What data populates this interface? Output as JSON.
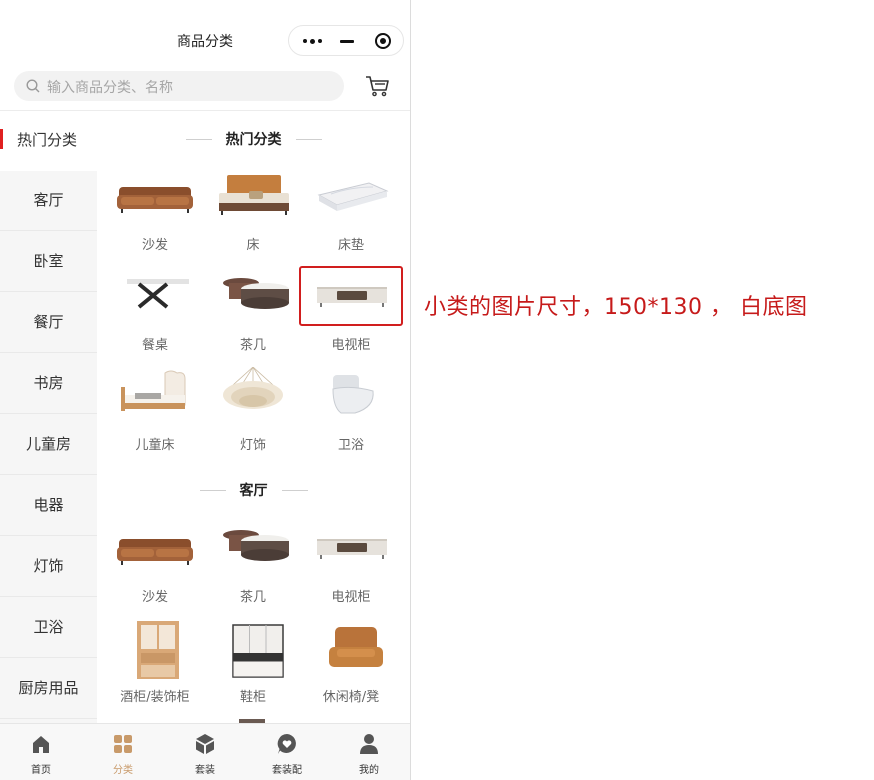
{
  "header": {
    "title": "商品分类"
  },
  "search": {
    "placeholder": "输入商品分类、名称"
  },
  "sidebar": {
    "items": [
      {
        "label": "热门分类",
        "active": true
      },
      {
        "label": "客厅"
      },
      {
        "label": "卧室"
      },
      {
        "label": "餐厅"
      },
      {
        "label": "书房"
      },
      {
        "label": "儿童房"
      },
      {
        "label": "电器"
      },
      {
        "label": "灯饰"
      },
      {
        "label": "卫浴"
      },
      {
        "label": "厨房用品"
      }
    ]
  },
  "sections": [
    {
      "title": "热门分类",
      "items": [
        {
          "label": "沙发",
          "icon": "sofa"
        },
        {
          "label": "床",
          "icon": "bed"
        },
        {
          "label": "床垫",
          "icon": "mattress"
        },
        {
          "label": "餐桌",
          "icon": "dining-table"
        },
        {
          "label": "茶几",
          "icon": "coffee-table"
        },
        {
          "label": "电视柜",
          "icon": "tv-cabinet"
        },
        {
          "label": "儿童床",
          "icon": "kids-bed"
        },
        {
          "label": "灯饰",
          "icon": "chandelier"
        },
        {
          "label": "卫浴",
          "icon": "toilet"
        }
      ]
    },
    {
      "title": "客厅",
      "items": [
        {
          "label": "沙发",
          "icon": "sofa"
        },
        {
          "label": "茶几",
          "icon": "coffee-table"
        },
        {
          "label": "电视柜",
          "icon": "tv-cabinet"
        },
        {
          "label": "酒柜/装饰柜",
          "icon": "wine-cabinet"
        },
        {
          "label": "鞋柜",
          "icon": "shoe-cabinet"
        },
        {
          "label": "休闲椅/凳",
          "icon": "lounge-chair"
        }
      ]
    }
  ],
  "tabbar": {
    "items": [
      {
        "label": "首页",
        "icon": "home-icon"
      },
      {
        "label": "分类",
        "icon": "category-icon",
        "active": true
      },
      {
        "label": "套装",
        "icon": "box-icon"
      },
      {
        "label": "套装配",
        "icon": "heart-chat-icon"
      },
      {
        "label": "我的",
        "icon": "user-icon"
      }
    ]
  },
  "annotation": {
    "text": "小类的图片尺寸，150*130 ， 白底图"
  },
  "colors": {
    "accent": "#e02020",
    "active_tab": "#c89a6a",
    "annotation": "#c61a1a"
  }
}
